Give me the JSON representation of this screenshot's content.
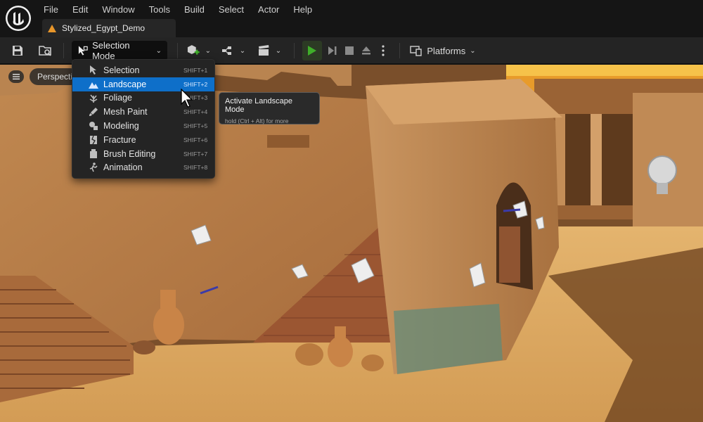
{
  "menu": {
    "items": [
      "File",
      "Edit",
      "Window",
      "Tools",
      "Build",
      "Select",
      "Actor",
      "Help"
    ]
  },
  "document_tab": {
    "title": "Stylized_Egypt_Demo"
  },
  "toolbar": {
    "mode_label": "Selection Mode",
    "platforms_label": "Platforms"
  },
  "viewport": {
    "perspective_label": "Perspective"
  },
  "mode_dropdown": {
    "items": [
      {
        "label": "Selection",
        "shortcut": "SHIFT+1",
        "icon": "selection-icon"
      },
      {
        "label": "Landscape",
        "shortcut": "SHIFT+2",
        "icon": "landscape-icon",
        "selected": true
      },
      {
        "label": "Foliage",
        "shortcut": "SHIFT+3",
        "icon": "foliage-icon"
      },
      {
        "label": "Mesh Paint",
        "shortcut": "SHIFT+4",
        "icon": "mesh-paint-icon"
      },
      {
        "label": "Modeling",
        "shortcut": "SHIFT+5",
        "icon": "modeling-icon"
      },
      {
        "label": "Fracture",
        "shortcut": "SHIFT+6",
        "icon": "fracture-icon"
      },
      {
        "label": "Brush Editing",
        "shortcut": "SHIFT+7",
        "icon": "brush-editing-icon"
      },
      {
        "label": "Animation",
        "shortcut": "SHIFT+8",
        "icon": "animation-icon"
      }
    ]
  },
  "tooltip": {
    "title": "Activate Landscape Mode",
    "hint": "hold (Ctrl + Alt) for more"
  },
  "colors": {
    "selection_highlight": "#0e6fc9",
    "play_green": "#3fae2a",
    "sand": "#dca865",
    "wall": "#b67a45"
  }
}
